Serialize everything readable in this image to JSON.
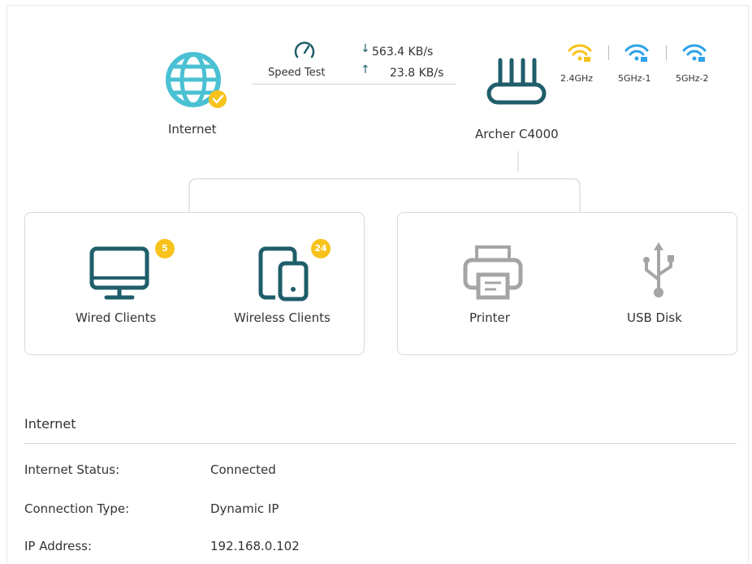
{
  "topology": {
    "internet_label": "Internet",
    "speed_test_label": "Speed Test",
    "download_speed": "563.4 KB/s",
    "upload_speed": "23.8 KB/s",
    "router_name": "Archer C4000",
    "bands": [
      "2.4GHz",
      "5GHz-1",
      "5GHz-2"
    ]
  },
  "clients": {
    "wired_label": "Wired Clients",
    "wired_count": "5",
    "wireless_label": "Wireless Clients",
    "wireless_count": "24",
    "printer_label": "Printer",
    "usb_label": "USB Disk"
  },
  "colors": {
    "internet_icon": "#4ac0d3",
    "check_badge": "#f7c21b",
    "wifi_24": "#f7c21b",
    "wifi_5": "#2fa3e8",
    "device_icon": "#1f5e6a",
    "inactive_icon": "#a5a5a5"
  },
  "internet_section": {
    "title": "Internet",
    "rows": [
      {
        "label": "Internet Status:",
        "value": "Connected"
      },
      {
        "label": "Connection Type:",
        "value": "Dynamic IP"
      },
      {
        "label": "IP Address:",
        "value": "192.168.0.102"
      }
    ]
  }
}
